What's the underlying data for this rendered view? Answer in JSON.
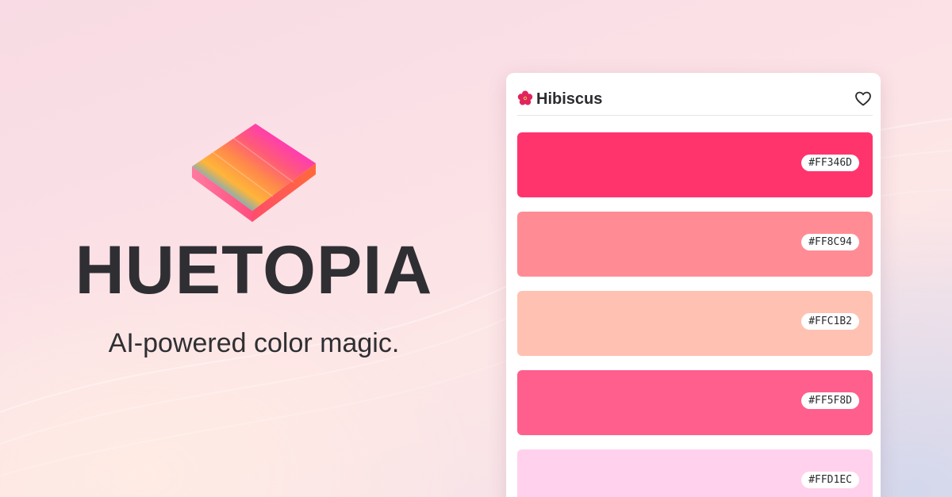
{
  "brand": {
    "name": "HUETOPIA",
    "tagline": "AI-powered color magic."
  },
  "palette": {
    "name": "Hibiscus",
    "icon": "hibiscus-flower-icon",
    "favorite_icon": "heart-outline-icon",
    "swatches": [
      {
        "hex": "#FF346D",
        "color": "#FF346D"
      },
      {
        "hex": "#FF8C94",
        "color": "#FF8C94"
      },
      {
        "hex": "#FFC1B2",
        "color": "#FFC1B2"
      },
      {
        "hex": "#FF5F8D",
        "color": "#FF5F8D"
      },
      {
        "hex": "#FFD1EC",
        "color": "#FFD1EC"
      }
    ]
  },
  "colors": {
    "text": "#2F2F33",
    "card": "#FFFFFF"
  }
}
